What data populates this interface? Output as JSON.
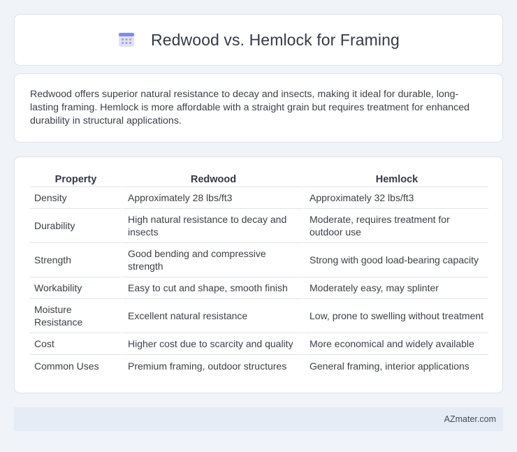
{
  "header": {
    "title": "Redwood vs. Hemlock for Framing",
    "icon": "calendar-grid-icon"
  },
  "intro": {
    "text": "Redwood offers superior natural resistance to decay and insects, making it ideal for durable, long-lasting framing. Hemlock is more affordable with a straight grain but requires treatment for enhanced durability in structural applications."
  },
  "table": {
    "headers": [
      "Property",
      "Redwood",
      "Hemlock"
    ],
    "rows": [
      [
        "Density",
        "Approximately 28 lbs/ft3",
        "Approximately 32 lbs/ft3"
      ],
      [
        "Durability",
        "High natural resistance to decay and insects",
        "Moderate, requires treatment for outdoor use"
      ],
      [
        "Strength",
        "Good bending and compressive strength",
        "Strong with good load-bearing capacity"
      ],
      [
        "Workability",
        "Easy to cut and shape, smooth finish",
        "Moderately easy, may splinter"
      ],
      [
        "Moisture Resistance",
        "Excellent natural resistance",
        "Low, prone to swelling without treatment"
      ],
      [
        "Cost",
        "Higher cost due to scarcity and quality",
        "More economical and widely available"
      ],
      [
        "Common Uses",
        "Premium framing, outdoor structures",
        "General framing, interior applications"
      ]
    ]
  },
  "footer": {
    "brand": "AZmater.com"
  }
}
